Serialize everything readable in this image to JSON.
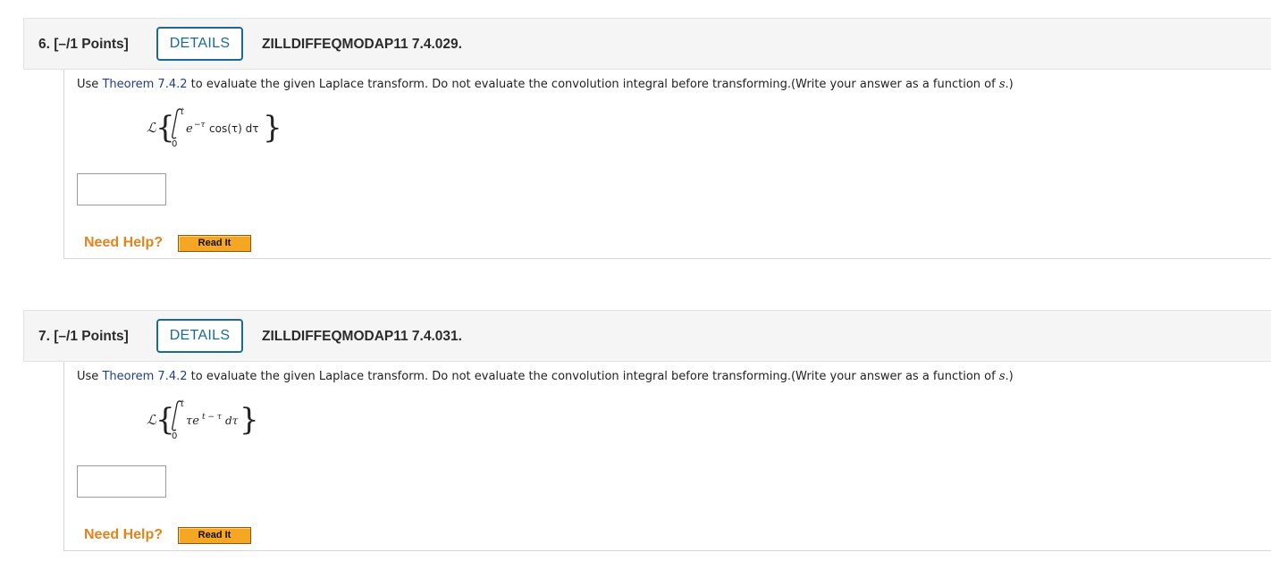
{
  "questions": [
    {
      "number": "6.",
      "points": "[–/1 Points]",
      "details_label": "DETAILS",
      "problem_id": "ZILLDIFFEQMODAP11 7.4.029.",
      "instruction_prefix": "Use",
      "theorem_link": "Theorem 7.4.2",
      "instruction_middle": "to evaluate the given Laplace transform. Do not evaluate the convolution integral before transforming.(Write your answer as a function of",
      "instruction_var": "s",
      "instruction_suffix": ".)",
      "formula": {
        "operator": "ℒ",
        "upper_limit": "t",
        "lower_limit": "0",
        "integrand": "e",
        "exponent": "−τ",
        "rest": "cos(τ) dτ"
      },
      "answer_value": "",
      "need_help_label": "Need Help?",
      "read_it_label": "Read It"
    },
    {
      "number": "7.",
      "points": "[–/1 Points]",
      "details_label": "DETAILS",
      "problem_id": "ZILLDIFFEQMODAP11 7.4.031.",
      "instruction_prefix": "Use",
      "theorem_link": "Theorem 7.4.2",
      "instruction_middle": "to evaluate the given Laplace transform. Do not evaluate the convolution integral before transforming.(Write your answer as a function of",
      "instruction_var": "s",
      "instruction_suffix": ".)",
      "formula": {
        "operator": "ℒ",
        "upper_limit": "t",
        "lower_limit": "0",
        "integrand": "τe",
        "exponent": "t − τ",
        "rest": "dτ"
      },
      "answer_value": "",
      "need_help_label": "Need Help?",
      "read_it_label": "Read It"
    }
  ],
  "colors": {
    "details_border": "#1b6a92",
    "need_help": "#e0841c",
    "read_it_bg": "#f5a623",
    "link": "#1f3d8c"
  }
}
